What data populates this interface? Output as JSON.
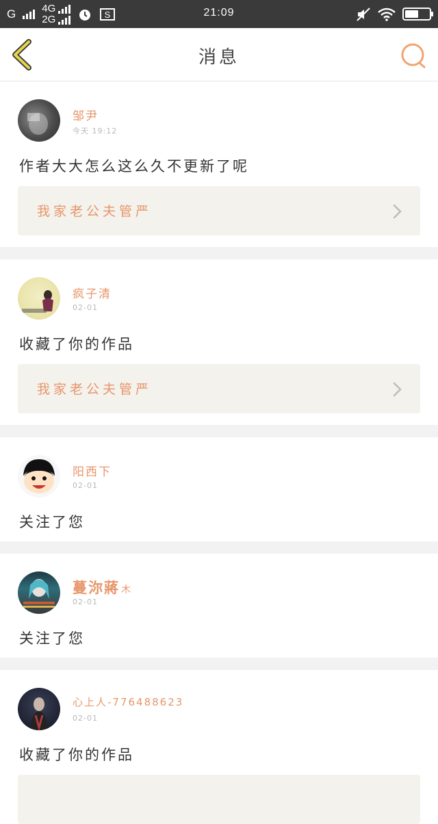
{
  "status_bar": {
    "carrier_g": "G",
    "net_4g": "4G",
    "net_2g": "2G",
    "time": "21:09",
    "battery_level": 0.55,
    "icons": [
      "signal-bars-icon",
      "alarm-icon",
      "screenshot-s-icon",
      "mute-icon",
      "wifi-icon",
      "battery-icon"
    ]
  },
  "nav": {
    "title": "消息",
    "back_icon": "chevron-left-icon",
    "search_icon": "search-icon",
    "accent_back": "#e8d54a",
    "accent_search": "#f0a46e"
  },
  "messages": [
    {
      "name": "邹尹",
      "time": "今天 19:12",
      "text": "作者大大怎么这么久不更新了呢",
      "ref": "我家老公夫管严"
    },
    {
      "name": "疯子清",
      "time": "02-01",
      "text": "收藏了你的作品",
      "ref": "我家老公夫管严"
    },
    {
      "name": "阳西下",
      "time": "02-01",
      "text": "关注了您"
    },
    {
      "name": "蔓沵蔣",
      "name_suffix": "木",
      "time": "02-01",
      "text": "关注了您"
    },
    {
      "name": "心上人-776488623",
      "time": "02-01",
      "text": "收藏了你的作品"
    }
  ],
  "colors": {
    "name": "#e8956a",
    "ref_bg": "#f3f2ec",
    "divider": "#f2f2f2"
  }
}
